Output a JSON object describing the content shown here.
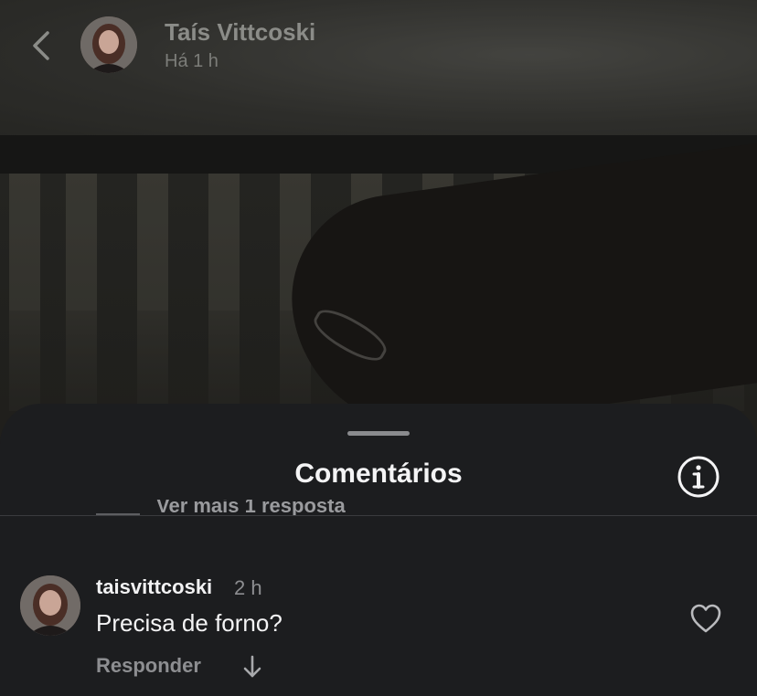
{
  "story": {
    "author_name": "Taís Vittcoski",
    "posted_time": "Há 1 h"
  },
  "sheet": {
    "title": "Comentários",
    "more_replies": "Ver mais 1 resposta"
  },
  "comment": {
    "username": "taisvittcoski",
    "time": "2 h",
    "text": "Precisa de forno?",
    "reply_label": "Responder"
  },
  "icons": {
    "back": "chevron-left-icon",
    "info": "info-icon",
    "like": "heart-icon",
    "expand": "arrow-down-icon"
  },
  "colors": {
    "sheet_bg": "#1c1d1f",
    "primary_text": "#f4f4f5",
    "secondary_text": "#8d8e91"
  }
}
